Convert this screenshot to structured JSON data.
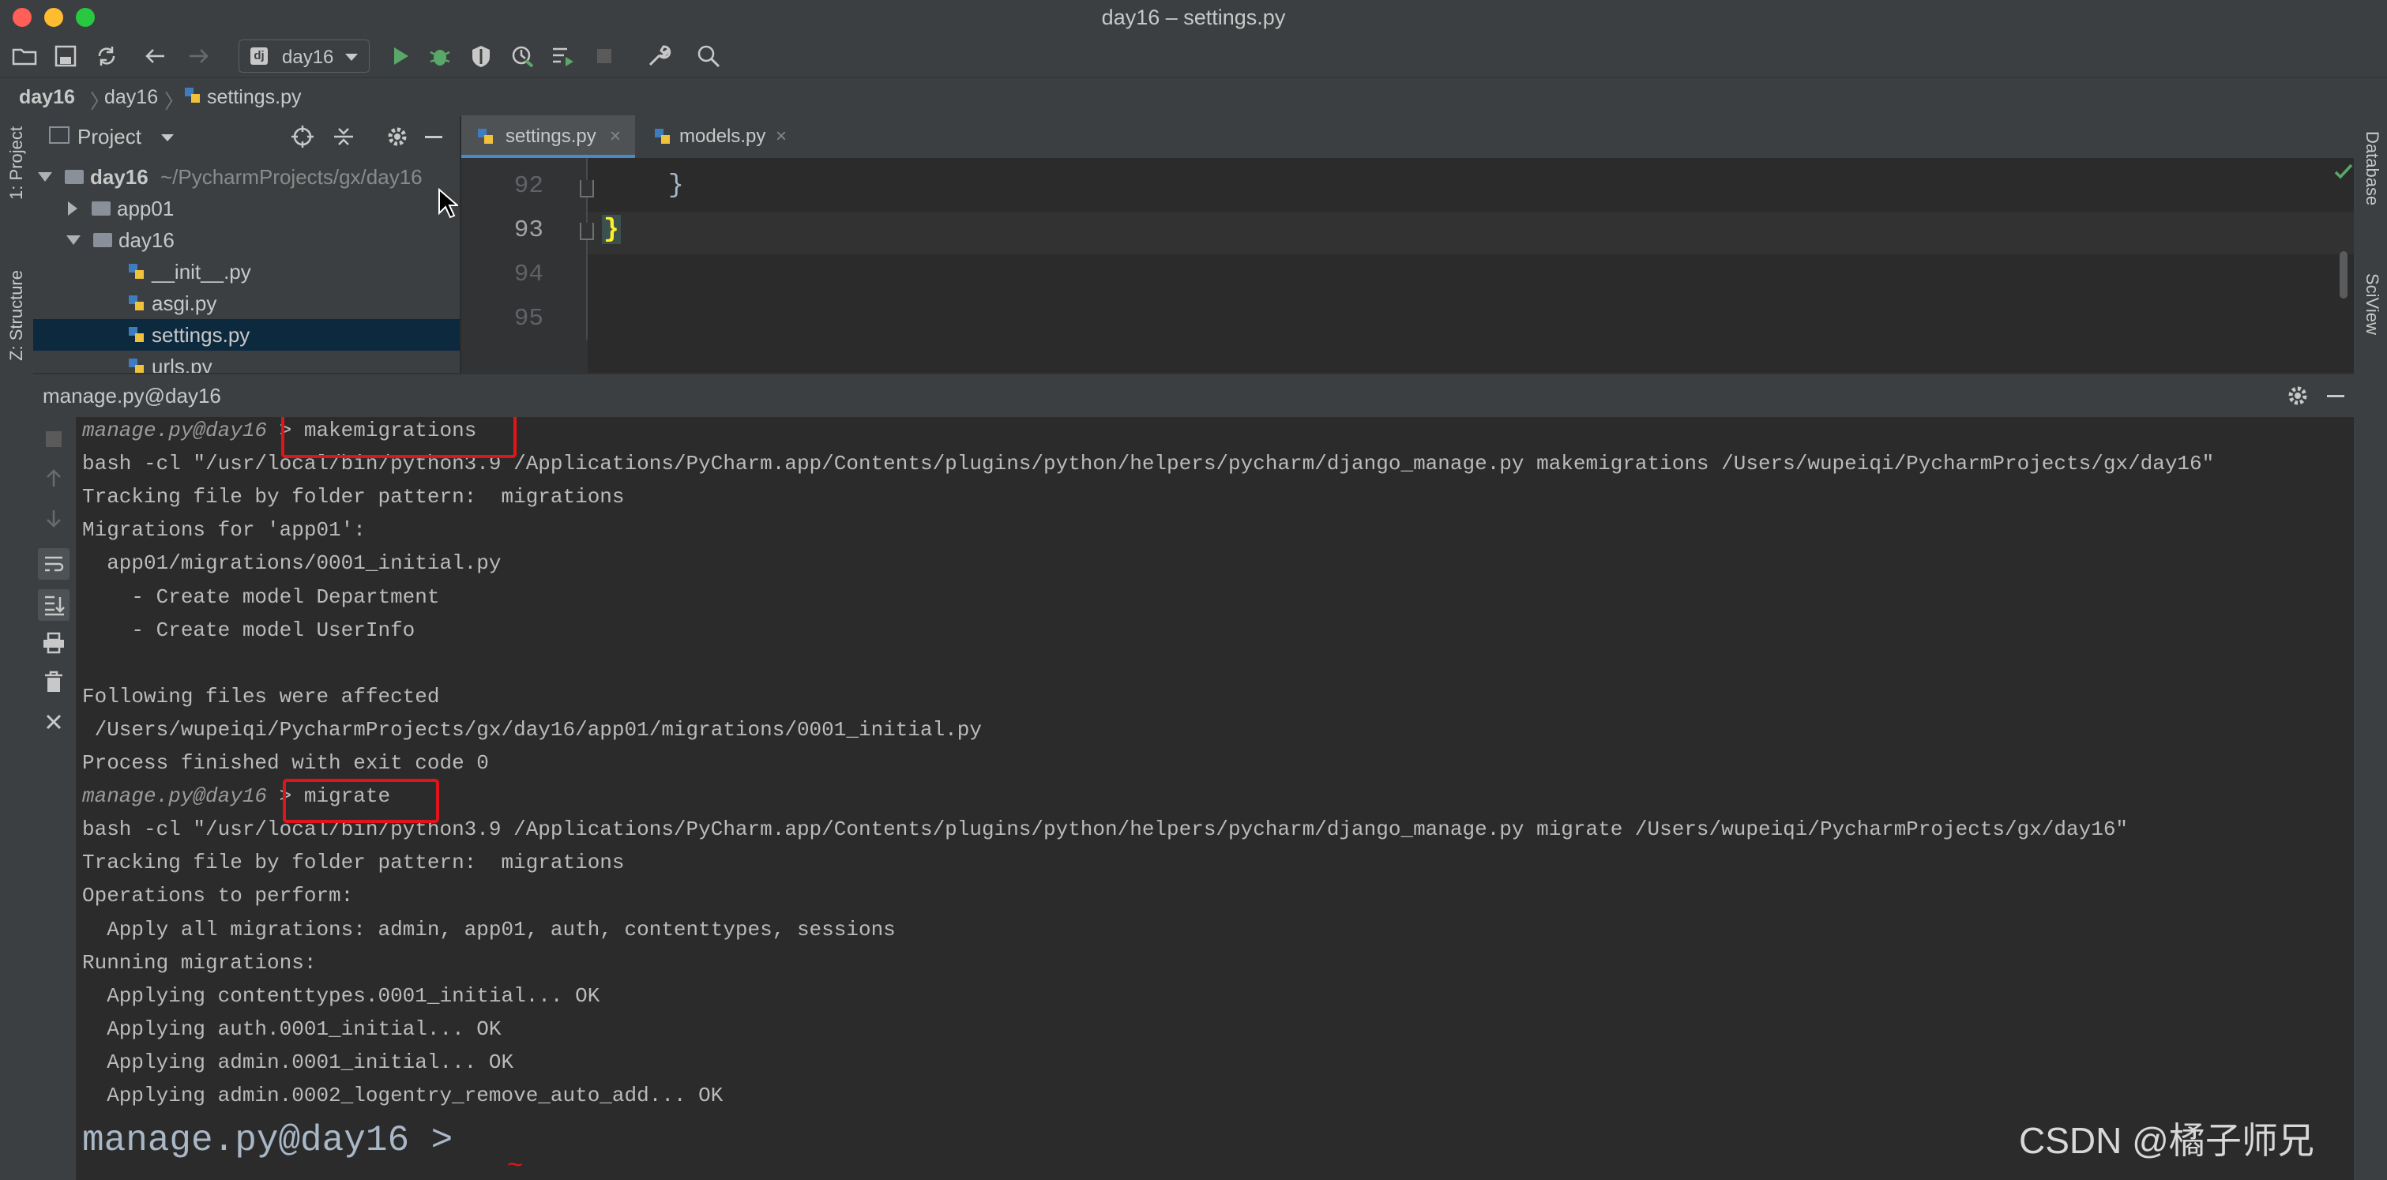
{
  "window": {
    "title": "day16 – settings.py"
  },
  "toolbar": {
    "run_config": "day16"
  },
  "breadcrumb": [
    "day16",
    "day16",
    "settings.py"
  ],
  "left_strip": {
    "project_tab": "1: Project",
    "structure_tab": "Z: Structure"
  },
  "right_strip": {
    "database_tab": "Database",
    "sciview_tab": "SciView"
  },
  "project": {
    "title": "Project",
    "tree": [
      {
        "name": "day16",
        "path": "~/PycharmProjects/gx/day16"
      },
      {
        "name": "app01"
      },
      {
        "name": "day16"
      },
      {
        "name": "__init__.py"
      },
      {
        "name": "asgi.py"
      },
      {
        "name": "settings.py"
      },
      {
        "name": "urls.py"
      }
    ]
  },
  "editor": {
    "tabs": [
      {
        "label": "settings.py"
      },
      {
        "label": "models.py"
      }
    ],
    "lines": [
      {
        "num": "92",
        "code": "}"
      },
      {
        "num": "93",
        "code": "}"
      },
      {
        "num": "94",
        "code": ""
      },
      {
        "num": "95",
        "code": ""
      }
    ]
  },
  "run": {
    "title": "manage.py@day16",
    "console": [
      {
        "prompt": "manage.py@day16",
        "text": "> makemigrations"
      },
      {
        "text": "bash -cl \"/usr/local/bin/python3.9 /Applications/PyCharm.app/Contents/plugins/python/helpers/pycharm/django_manage.py makemigrations /Users/wupeiqi/PycharmProjects/gx/day16\""
      },
      {
        "text": "Tracking file by folder pattern:  migrations"
      },
      {
        "text": "Migrations for 'app01':"
      },
      {
        "text": "  app01/migrations/0001_initial.py"
      },
      {
        "text": "    - Create model Department"
      },
      {
        "text": "    - Create model UserInfo"
      },
      {
        "text": ""
      },
      {
        "text": "Following files were affected"
      },
      {
        "text": " /Users/wupeiqi/PycharmProjects/gx/day16/app01/migrations/0001_initial.py"
      },
      {
        "text": "Process finished with exit code 0"
      },
      {
        "prompt": "manage.py@day16",
        "text": "> migrate"
      },
      {
        "text": "bash -cl \"/usr/local/bin/python3.9 /Applications/PyCharm.app/Contents/plugins/python/helpers/pycharm/django_manage.py migrate /Users/wupeiqi/PycharmProjects/gx/day16\""
      },
      {
        "text": "Tracking file by folder pattern:  migrations"
      },
      {
        "text": "Operations to perform:"
      },
      {
        "text": "  Apply all migrations: admin, app01, auth, contenttypes, sessions"
      },
      {
        "text": "Running migrations:"
      },
      {
        "text": "  Applying contenttypes.0001_initial... OK"
      },
      {
        "text": "  Applying auth.0001_initial... OK"
      },
      {
        "text": "  Applying admin.0001_initial... OK"
      },
      {
        "text": "  Applying admin.0002_logentry_remove_auto_add... OK"
      }
    ],
    "input_prompt": "manage.py@day16 >"
  },
  "watermark": "CSDN @橘子师兄",
  "colors": {
    "accent": "#4a88c7",
    "highlight_box": "#e0151a",
    "background": "#2b2b2b",
    "panel": "#3c3f41"
  }
}
